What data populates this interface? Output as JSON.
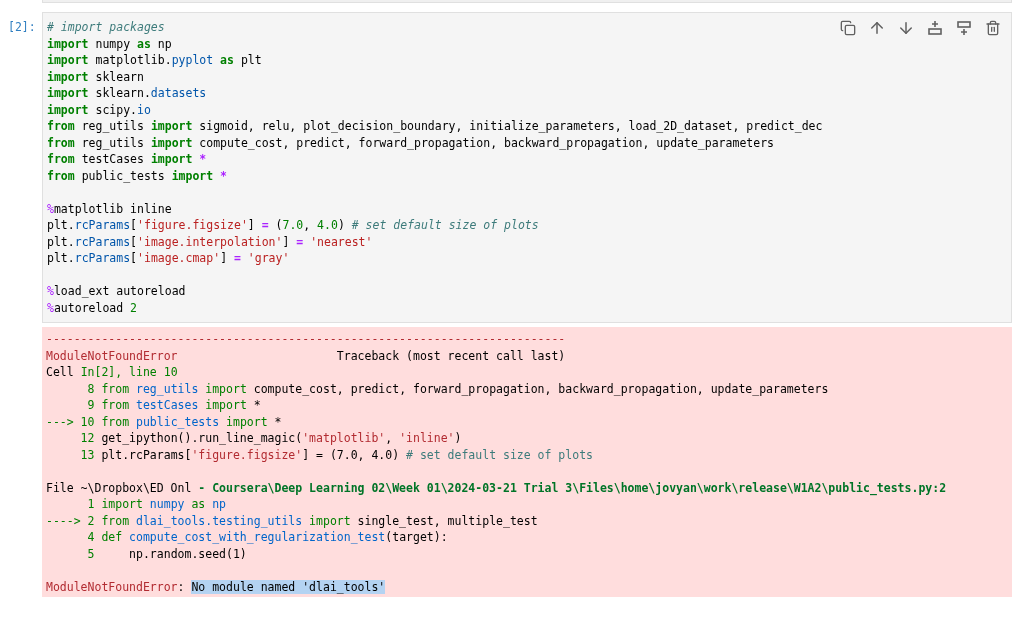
{
  "cell": {
    "prompt": "[2]:",
    "code": [
      [
        [
          {
            "kind": "comment",
            "text": "# import packages"
          }
        ],
        [
          {
            "kind": "keyword",
            "text": "import"
          },
          {
            "kind": "plain",
            "text": " numpy "
          },
          {
            "kind": "keyword",
            "text": "as"
          },
          {
            "kind": "plain",
            "text": " np"
          }
        ],
        [
          {
            "kind": "keyword",
            "text": "import"
          },
          {
            "kind": "plain",
            "text": " matplotlib."
          },
          {
            "kind": "attr",
            "text": "pyplot"
          },
          {
            "kind": "keyword",
            "text": " as"
          },
          {
            "kind": "plain",
            "text": " plt"
          }
        ],
        [
          {
            "kind": "keyword",
            "text": "import"
          },
          {
            "kind": "plain",
            "text": " sklearn"
          }
        ],
        [
          {
            "kind": "keyword",
            "text": "import"
          },
          {
            "kind": "plain",
            "text": " sklearn."
          },
          {
            "kind": "attr",
            "text": "datasets"
          }
        ],
        [
          {
            "kind": "keyword",
            "text": "import"
          },
          {
            "kind": "plain",
            "text": " scipy."
          },
          {
            "kind": "attr",
            "text": "io"
          }
        ],
        [
          {
            "kind": "keyword",
            "text": "from"
          },
          {
            "kind": "plain",
            "text": " reg_utils "
          },
          {
            "kind": "keyword",
            "text": "import"
          },
          {
            "kind": "plain",
            "text": " sigmoid, relu, plot_decision_boundary, initialize_parameters, load_2D_dataset, predict_dec"
          }
        ],
        [
          {
            "kind": "keyword",
            "text": "from"
          },
          {
            "kind": "plain",
            "text": " reg_utils "
          },
          {
            "kind": "keyword",
            "text": "import"
          },
          {
            "kind": "plain",
            "text": " compute_cost, predict, forward_propagation, backward_propagation, update_parameters"
          }
        ],
        [
          {
            "kind": "keyword",
            "text": "from"
          },
          {
            "kind": "plain",
            "text": " testCases "
          },
          {
            "kind": "keyword",
            "text": "import"
          },
          {
            "kind": "operator",
            "text": " *"
          }
        ],
        [
          {
            "kind": "keyword",
            "text": "from"
          },
          {
            "kind": "plain",
            "text": " public_tests "
          },
          {
            "kind": "keyword",
            "text": "import"
          },
          {
            "kind": "operator",
            "text": " *"
          }
        ]
      ],
      [
        [
          {
            "kind": "magic",
            "text": "%"
          },
          {
            "kind": "plain",
            "text": "matplotlib inline"
          }
        ],
        [
          {
            "kind": "plain",
            "text": "plt."
          },
          {
            "kind": "attr",
            "text": "rcParams"
          },
          {
            "kind": "plain",
            "text": "["
          },
          {
            "kind": "string",
            "text": "'figure.figsize'"
          },
          {
            "kind": "plain",
            "text": "] "
          },
          {
            "kind": "operator",
            "text": "="
          },
          {
            "kind": "plain",
            "text": " ("
          },
          {
            "kind": "number",
            "text": "7.0"
          },
          {
            "kind": "plain",
            "text": ", "
          },
          {
            "kind": "number",
            "text": "4.0"
          },
          {
            "kind": "plain",
            "text": ") "
          },
          {
            "kind": "comment",
            "text": "# set default size of plots"
          }
        ],
        [
          {
            "kind": "plain",
            "text": "plt."
          },
          {
            "kind": "attr",
            "text": "rcParams"
          },
          {
            "kind": "plain",
            "text": "["
          },
          {
            "kind": "string",
            "text": "'image.interpolation'"
          },
          {
            "kind": "plain",
            "text": "] "
          },
          {
            "kind": "operator",
            "text": "="
          },
          {
            "kind": "string",
            "text": " 'nearest'"
          }
        ],
        [
          {
            "kind": "plain",
            "text": "plt."
          },
          {
            "kind": "attr",
            "text": "rcParams"
          },
          {
            "kind": "plain",
            "text": "["
          },
          {
            "kind": "string",
            "text": "'image.cmap'"
          },
          {
            "kind": "plain",
            "text": "] "
          },
          {
            "kind": "operator",
            "text": "="
          },
          {
            "kind": "string",
            "text": " 'gray'"
          }
        ]
      ],
      [
        [
          {
            "kind": "magic",
            "text": "%"
          },
          {
            "kind": "plain",
            "text": "load_ext autoreload"
          }
        ],
        [
          {
            "kind": "magic",
            "text": "%"
          },
          {
            "kind": "plain",
            "text": "autoreload "
          },
          {
            "kind": "number",
            "text": "2"
          }
        ]
      ]
    ]
  },
  "output": {
    "kind": "error",
    "blocks": [
      [
        [
          {
            "kind": "error",
            "text": "---------------------------------------------------------------------------"
          }
        ],
        [
          {
            "kind": "error",
            "text": "ModuleNotFoundError"
          },
          {
            "kind": "plain",
            "text": "                       Traceback (most recent call last)"
          }
        ],
        [
          {
            "kind": "plain",
            "text": "Cell "
          },
          {
            "kind": "lineno",
            "text": "In[2], line 10"
          }
        ],
        [
          {
            "kind": "lineno",
            "text": "      8 "
          },
          {
            "kind": "keyword",
            "text": "from"
          },
          {
            "kind": "module",
            "text": " reg_utils"
          },
          {
            "kind": "keyword",
            "text": " import"
          },
          {
            "kind": "plain",
            "text": " compute_cost, predict, forward_propagation, backward_propagation, update_parameters"
          }
        ],
        [
          {
            "kind": "lineno",
            "text": "      9 "
          },
          {
            "kind": "keyword",
            "text": "from"
          },
          {
            "kind": "module",
            "text": " testCases"
          },
          {
            "kind": "keyword",
            "text": " import"
          },
          {
            "kind": "plain",
            "text": " *"
          }
        ],
        [
          {
            "kind": "lineno",
            "text": "---> 10 "
          },
          {
            "kind": "keyword",
            "text": "from"
          },
          {
            "kind": "module",
            "text": " public_tests"
          },
          {
            "kind": "keyword",
            "text": " import"
          },
          {
            "kind": "plain",
            "text": " *"
          }
        ],
        [
          {
            "kind": "lineno",
            "text": "     12 "
          },
          {
            "kind": "plain",
            "text": "get_ipython().run_line_magic("
          },
          {
            "kind": "string",
            "text": "'matplotlib'"
          },
          {
            "kind": "plain",
            "text": ", "
          },
          {
            "kind": "string",
            "text": "'inline'"
          },
          {
            "kind": "plain",
            "text": ")"
          }
        ],
        [
          {
            "kind": "lineno",
            "text": "     13 "
          },
          {
            "kind": "plain",
            "text": "plt.rcParams["
          },
          {
            "kind": "string",
            "text": "'figure.figsize'"
          },
          {
            "kind": "plain",
            "text": "] = (7.0, 4.0) "
          },
          {
            "kind": "comment",
            "text": "# set default size of plots"
          }
        ]
      ],
      [
        [
          {
            "kind": "plain",
            "text": "File ~\\Dropbox\\ED Onl "
          },
          {
            "kind": "path",
            "text": "- Coursera\\Deep Learning 02\\Week 01\\2024-03-21 Trial 3\\Files\\home\\jovyan\\work\\release\\W1A2\\public_tests.py:2"
          }
        ],
        [
          {
            "kind": "lineno",
            "text": "      1 "
          },
          {
            "kind": "keyword",
            "text": "import"
          },
          {
            "kind": "module",
            "text": " numpy"
          },
          {
            "kind": "keyword",
            "text": " as"
          },
          {
            "kind": "module",
            "text": " np"
          }
        ],
        [
          {
            "kind": "lineno",
            "text": "----> 2 "
          },
          {
            "kind": "keyword",
            "text": "from"
          },
          {
            "kind": "module",
            "text": " dlai_tools.testing_utils"
          },
          {
            "kind": "keyword",
            "text": " import"
          },
          {
            "kind": "plain",
            "text": " single_test, multiple_test"
          }
        ],
        [
          {
            "kind": "lineno",
            "text": "      4 "
          },
          {
            "kind": "keyword",
            "text": "def"
          },
          {
            "kind": "module",
            "text": " compute_cost_with_regularization_test"
          },
          {
            "kind": "plain",
            "text": "(target):"
          }
        ],
        [
          {
            "kind": "lineno",
            "text": "      5 "
          },
          {
            "kind": "plain",
            "text": "    np.random.seed(1)"
          }
        ]
      ],
      [
        [
          {
            "kind": "error",
            "text": "ModuleNotFoundError"
          },
          {
            "kind": "plain",
            "text": ": "
          },
          {
            "kind": "highlight",
            "text": "No module named 'dlai_tools'"
          }
        ]
      ]
    ]
  }
}
